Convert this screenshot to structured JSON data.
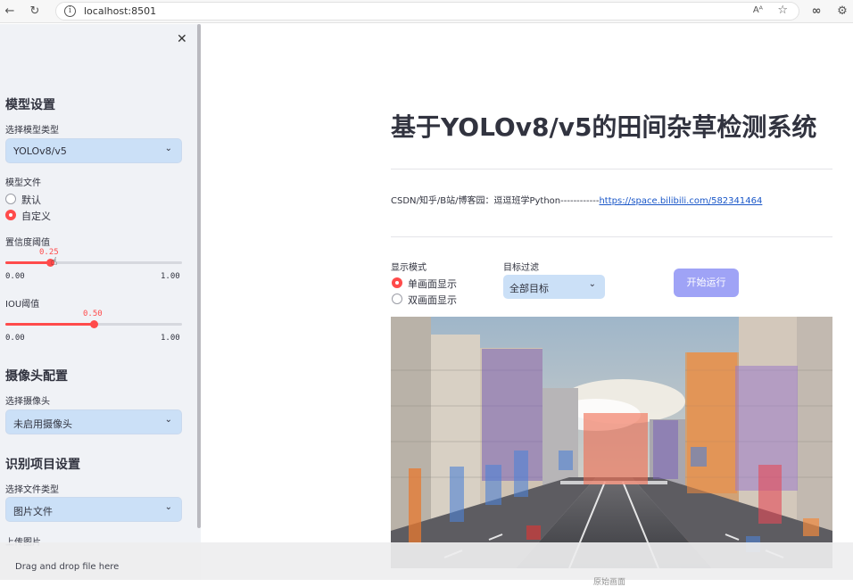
{
  "browser": {
    "url": "localhost:8501",
    "read_aloud_label": "Aᴬ"
  },
  "sidebar": {
    "close_label": "✕",
    "model_section": {
      "title": "模型设置",
      "model_type_label": "选择模型类型",
      "model_type_value": "YOLOv8/v5",
      "model_file_label": "模型文件",
      "model_file_options": [
        {
          "label": "默认",
          "selected": false
        },
        {
          "label": "自定义",
          "selected": true
        }
      ],
      "conf_label": "置信度阈值",
      "conf_value": "0.25",
      "conf_fraction": 0.25,
      "conf_min": "0.00",
      "conf_max": "1.00",
      "iou_label": "IOU阈值",
      "iou_value": "0.50",
      "iou_fraction": 0.5,
      "iou_min": "0.00",
      "iou_max": "1.00"
    },
    "camera_section": {
      "title": "摄像头配置",
      "camera_label": "选择摄像头",
      "camera_value": "未启用摄像头"
    },
    "project_section": {
      "title": "识别项目设置",
      "file_type_label": "选择文件类型",
      "file_type_value": "图片文件",
      "upload_label": "上传图片",
      "upload_hint": "Drag and drop file here"
    }
  },
  "main": {
    "title": "基于YOLOv8/v5的田间杂草检测系统",
    "info_prefix": "CSDN/知乎/B站/博客园：逗逗班学Python------------",
    "info_link": "https://space.bilibili.com/582341464",
    "display_mode_label": "显示模式",
    "display_mode_options": [
      {
        "label": "单画面显示",
        "selected": true
      },
      {
        "label": "双画面显示",
        "selected": false
      }
    ],
    "target_filter_label": "目标过滤",
    "target_filter_value": "全部目标",
    "run_button": "开始运行",
    "image_caption": "原始画面"
  },
  "colors": {
    "accent": "#ff4b4b",
    "select_bg": "#cbe0f7",
    "button_bg": "#9fa3f6",
    "sidebar_bg": "#f0f2f6",
    "link": "#1a57c8"
  }
}
